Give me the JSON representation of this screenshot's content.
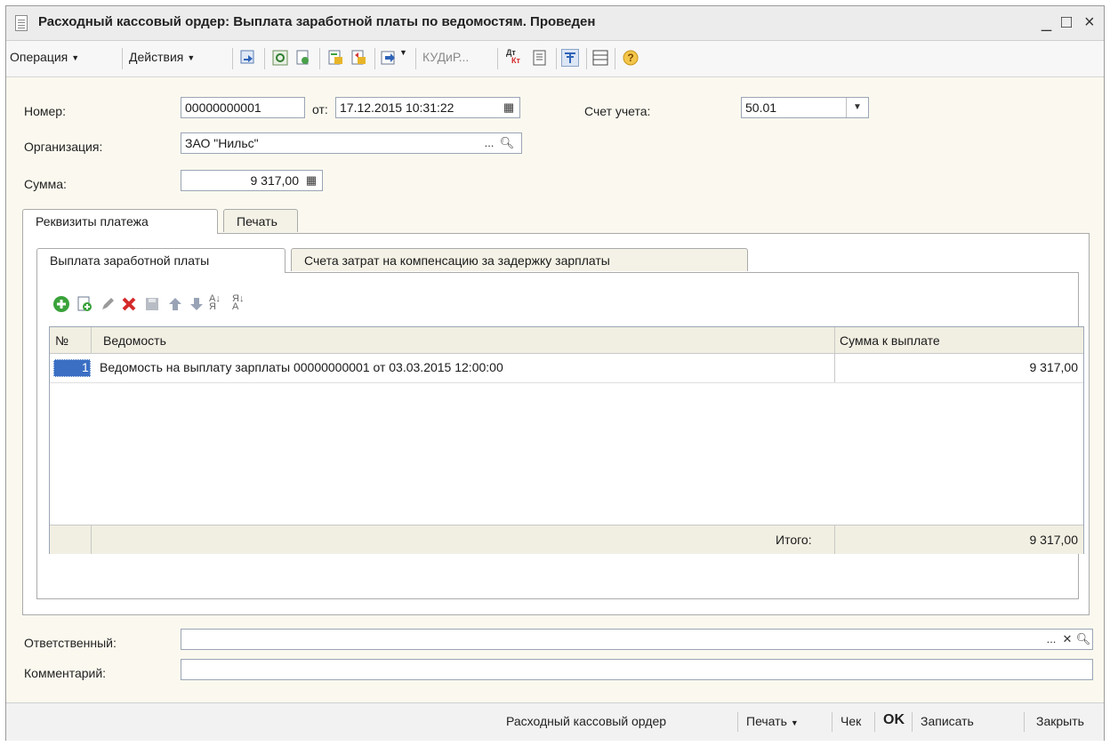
{
  "window": {
    "title": "Расходный кассовый ордер: Выплата заработной платы по ведомостям. Проведен",
    "controls": {
      "minimize": "_",
      "maximize": "□",
      "close": "×"
    }
  },
  "toolbar": {
    "operation_label": "Операция",
    "actions_label": "Действия",
    "kud_label": "КУДиР...",
    "dtkt_label": "Дт\nКт"
  },
  "form": {
    "number_label": "Номер:",
    "number_value": "00000000001",
    "from_label": "от:",
    "date_value": "17.12.2015 10:31:22",
    "account_label": "Счет учета:",
    "account_value": "50.01",
    "org_label": "Организация:",
    "org_value": "ЗАО \"Нильс\"",
    "sum_label": "Сумма:",
    "sum_value": "9 317,00"
  },
  "tabs": {
    "outer": [
      "Реквизиты платежа",
      "Печать"
    ],
    "inner": [
      "Выплата заработной платы",
      "Счета затрат на компенсацию за задержку зарплаты"
    ]
  },
  "grid": {
    "columns": [
      "№",
      "Ведомость",
      "Сумма к выплате"
    ],
    "rows": [
      {
        "n": "1",
        "statement": "Ведомость на выплату зарплаты 00000000001 от 03.03.2015 12:00:00",
        "amount": "9 317,00"
      }
    ],
    "total_label": "Итого:",
    "total_value": "9 317,00"
  },
  "footer_fields": {
    "responsible_label": "Ответственный:",
    "responsible_value": "",
    "comment_label": "Комментарий:",
    "comment_value": ""
  },
  "bottom": {
    "rko_label": "Расходный кассовый ордер",
    "print_label": "Печать",
    "check_label": "Чек",
    "ok_label": "OK",
    "save_label": "Записать",
    "close_label": "Закрыть"
  },
  "colors": {
    "selection": "#3a6fc4",
    "form_bg": "#fbf9ef",
    "add_green": "#3aa23a",
    "delete_red": "#d42a2a"
  }
}
